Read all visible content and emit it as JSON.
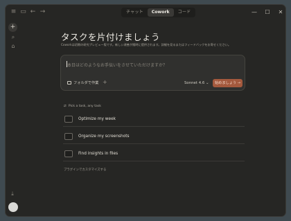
{
  "tabs": [
    {
      "label": "チャット",
      "active": false
    },
    {
      "label": "Cowork",
      "active": true
    },
    {
      "label": "コード",
      "active": false
    }
  ],
  "titlebar_icons": [
    "menu-icon",
    "sidebar-toggle-icon",
    "back-arrow-icon",
    "forward-arrow-icon"
  ],
  "window_controls": {
    "minimize": "—",
    "maximize": "☐",
    "close": "✕"
  },
  "sidebar": {
    "new": "+",
    "search": "⌕",
    "briefcase": "⌂",
    "download": "⤓"
  },
  "heading": "タスクを片付けましょう",
  "subtitle": "Coworkは初期の研究プレビュー版です。新しい改善が随時に提供されます。詳細を見るまたはフィードバックをお寄せください。",
  "composer": {
    "placeholder": "本日はどのようなお手伝いをさせていただけますか？",
    "folder_label": "フォルダで作業",
    "plus": "+",
    "model": "Sonnet 4.6",
    "model_chevron": "⌄",
    "start_label": "始めましょう →"
  },
  "pick_label": "Pick a task, any task",
  "tasks": [
    {
      "label": "Optimize my week"
    },
    {
      "label": "Organize my screenshots"
    },
    {
      "label": "Find insights in files"
    }
  ],
  "plugin_link": "プラグインでカスタマイズする",
  "colors": {
    "accent": "#a4593d",
    "background": "#262624",
    "composer": "#30302e"
  }
}
